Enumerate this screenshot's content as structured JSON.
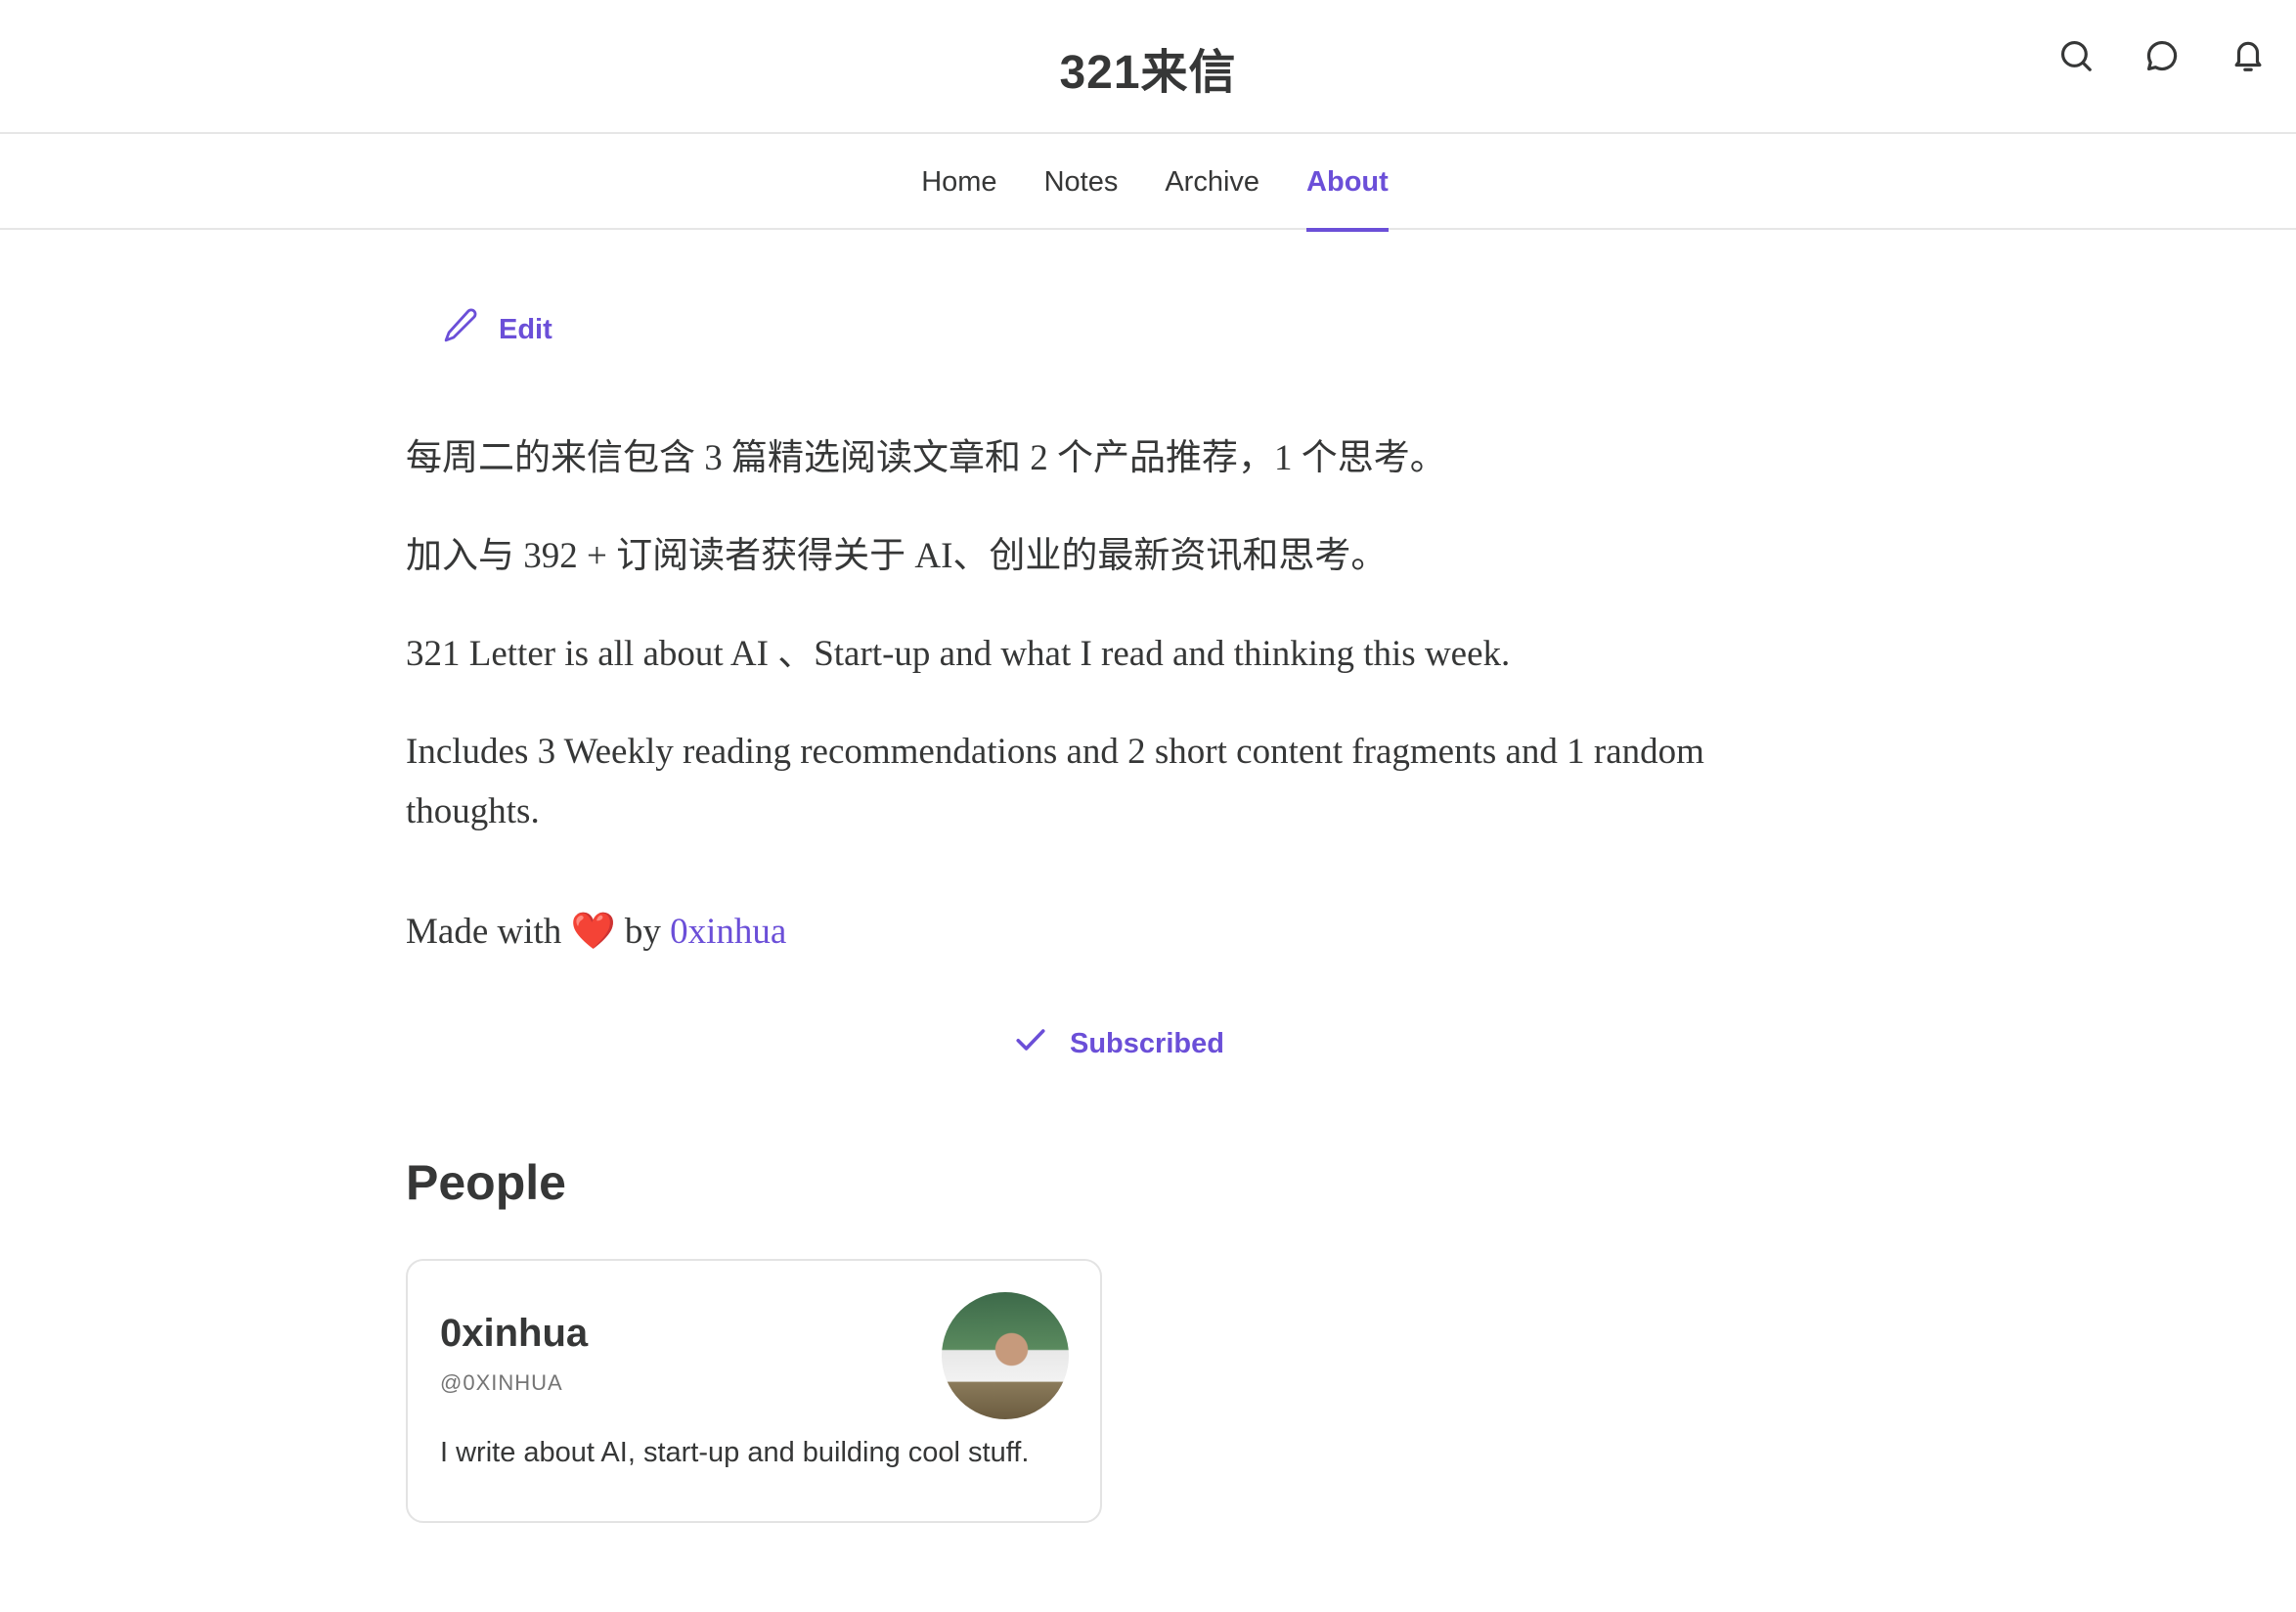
{
  "header": {
    "site_title": "321来信",
    "icons": [
      "search-icon",
      "chat-bubble-icon",
      "bell-icon"
    ]
  },
  "nav": {
    "tabs": [
      {
        "label": "Home",
        "active": false
      },
      {
        "label": "Notes",
        "active": false
      },
      {
        "label": "Archive",
        "active": false
      },
      {
        "label": "About",
        "active": true
      }
    ]
  },
  "edit": {
    "label": "Edit",
    "icon": "pencil-icon"
  },
  "about": {
    "p1": "每周二的来信包含 3 篇精选阅读文章和 2 个产品推荐，1 个思考。",
    "p2": "加入与 392 + 订阅读者获得关于 AI、创业的最新资讯和思考。",
    "p3": "321 Letter is all about AI 、Start-up and what I read and thinking this week.",
    "p4": "Includes 3 Weekly reading recommendations and 2 short content fragments and 1 random thoughts.",
    "made_with_prefix": "Made with ",
    "heart": "❤️",
    "made_with_by": " by ",
    "author_link": "0xinhua"
  },
  "subscribe": {
    "label": "Subscribed",
    "icon": "checkmark-icon"
  },
  "people": {
    "heading": "People",
    "cards": [
      {
        "name": "0xinhua",
        "handle": "@0XINHUA",
        "bio": "I write about AI, start-up and building cool stuff."
      }
    ]
  },
  "colors": {
    "accent": "#6b4fd8",
    "text": "#363737",
    "border": "#e6e6e6"
  }
}
